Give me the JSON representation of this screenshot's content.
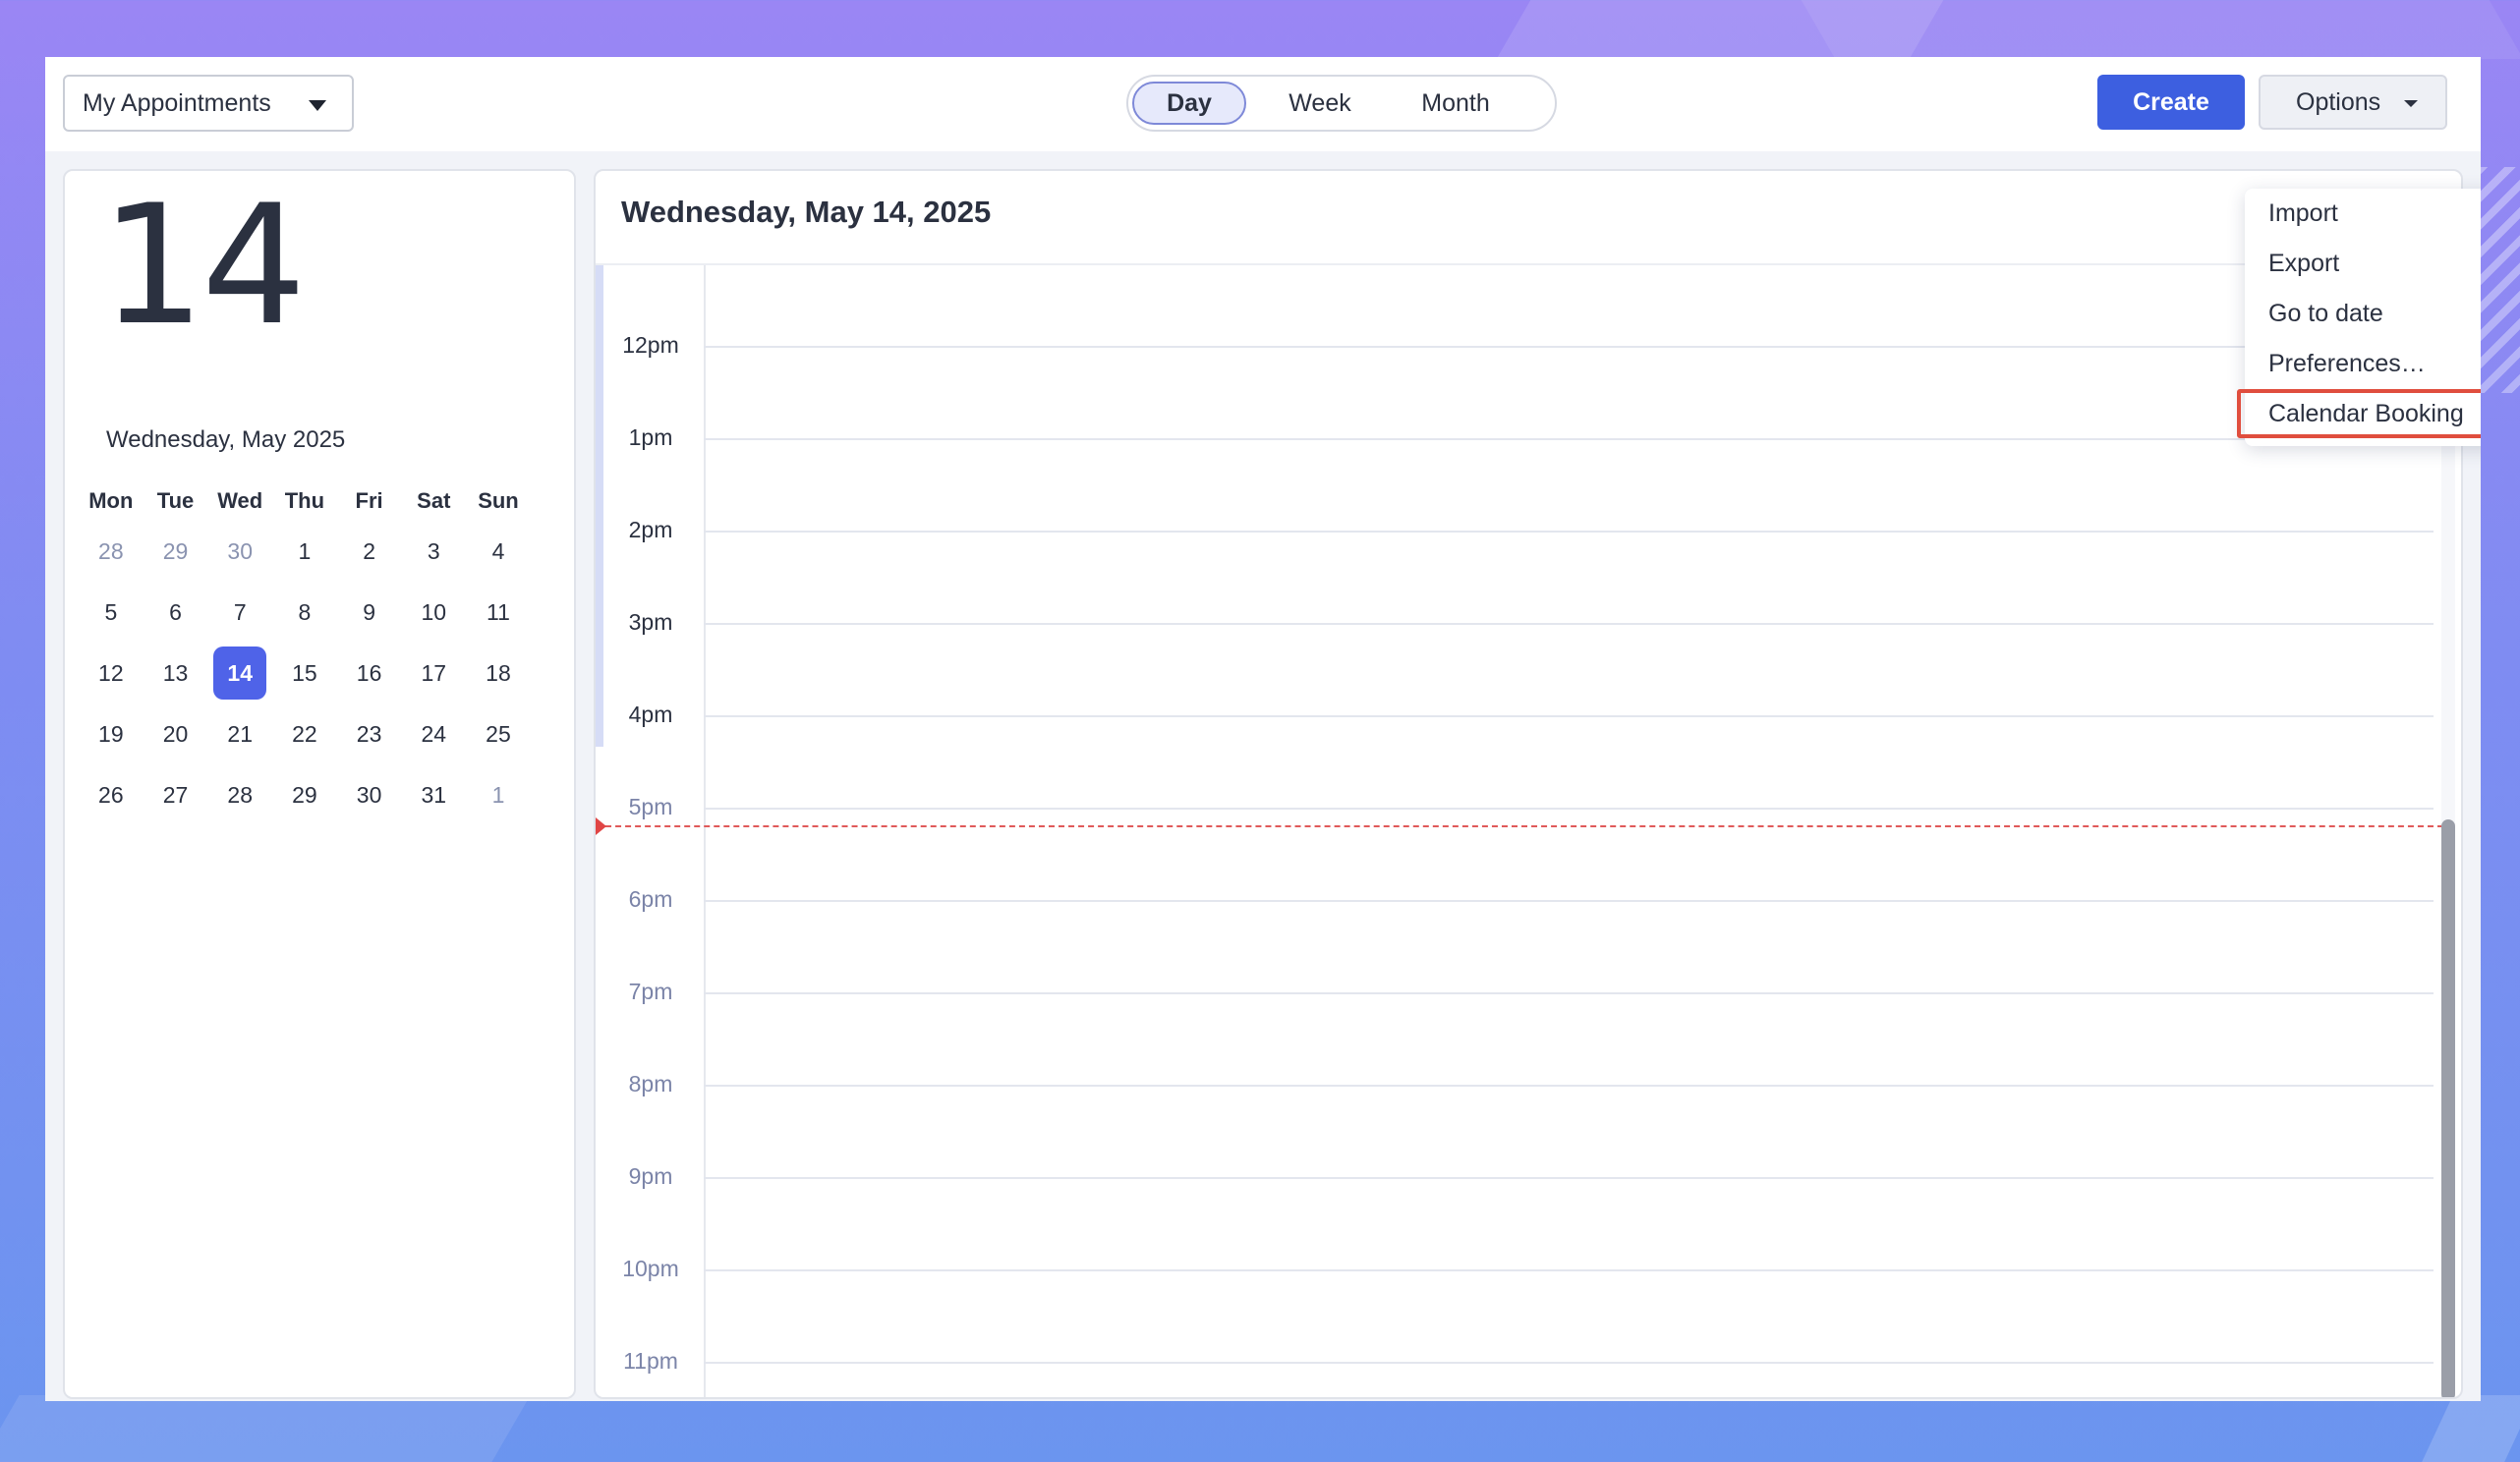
{
  "toolbar": {
    "appointments_select": "My Appointments",
    "views": {
      "day": "Day",
      "week": "Week",
      "month": "Month"
    },
    "active_view": "Day",
    "create_label": "Create",
    "options_label": "Options"
  },
  "options_menu": {
    "items": [
      "Import",
      "Export",
      "Go to date",
      "Preferences…",
      "Calendar Booking"
    ],
    "highlighted": "Calendar Booking"
  },
  "mini_calendar": {
    "big_day": "14",
    "date_label": "Wednesday, May 2025",
    "weekdays": [
      "Mon",
      "Tue",
      "Wed",
      "Thu",
      "Fri",
      "Sat",
      "Sun"
    ],
    "weeks": [
      [
        "28",
        "29",
        "30",
        "1",
        "2",
        "3",
        "4"
      ],
      [
        "5",
        "6",
        "7",
        "8",
        "9",
        "10",
        "11"
      ],
      [
        "12",
        "13",
        "14",
        "15",
        "16",
        "17",
        "18"
      ],
      [
        "19",
        "20",
        "21",
        "22",
        "23",
        "24",
        "25"
      ],
      [
        "26",
        "27",
        "28",
        "29",
        "30",
        "31",
        "1"
      ]
    ],
    "selected": "14"
  },
  "day_view": {
    "title": "Wednesday, May 14, 2025",
    "hours": [
      "12pm",
      "1pm",
      "2pm",
      "3pm",
      "4pm",
      "5pm",
      "6pm",
      "7pm",
      "8pm",
      "9pm",
      "10pm",
      "11pm"
    ]
  },
  "colors": {
    "accent": "#3d5fe0",
    "selected_day": "#4f63e8",
    "now_line": "#e05a5a",
    "highlight_box": "#e04e3e"
  }
}
